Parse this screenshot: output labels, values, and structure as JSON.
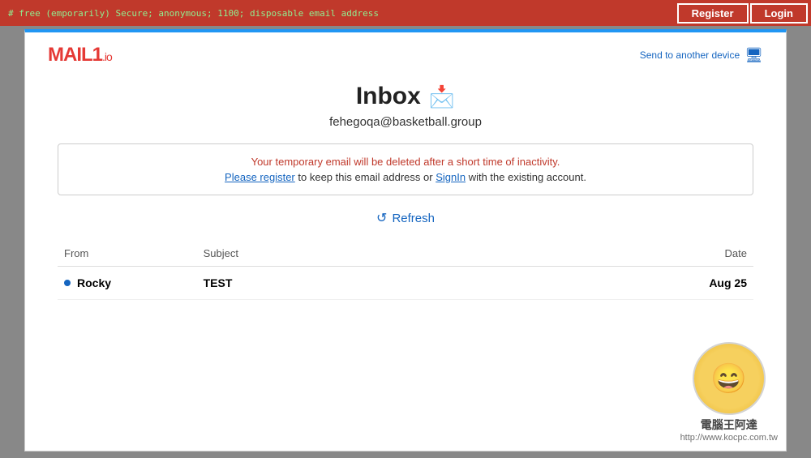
{
  "topbar": {
    "url_text": "# free (emporarily) Secure; anonymous; 1100; disposable email address",
    "register_label": "Register",
    "login_label": "Login"
  },
  "header": {
    "logo_text": "MAIL1",
    "logo_suffix": ".io",
    "send_to_device_label": "Send to another device"
  },
  "main": {
    "inbox_title": "Inbox",
    "email_address": "fehegoqa@basketball.group",
    "notice_warning": "Your temporary email will be deleted after a short time of inactivity.",
    "notice_info_prefix": "Please register",
    "notice_info_register_link": "Please register",
    "notice_info_middle": " to keep this email address or ",
    "notice_info_signin_link": "SignIn",
    "notice_info_suffix": "  with the existing account.",
    "refresh_label": "Refresh",
    "table": {
      "col_from": "From",
      "col_subject": "Subject",
      "col_date": "Date",
      "rows": [
        {
          "unread": true,
          "from": "Rocky",
          "subject": "TEST",
          "date": "Aug 25"
        }
      ]
    }
  },
  "watermark": {
    "face_emoji": "😄",
    "text1": "電腦王阿達",
    "text2": "http://www.kocpc.com.tw"
  }
}
